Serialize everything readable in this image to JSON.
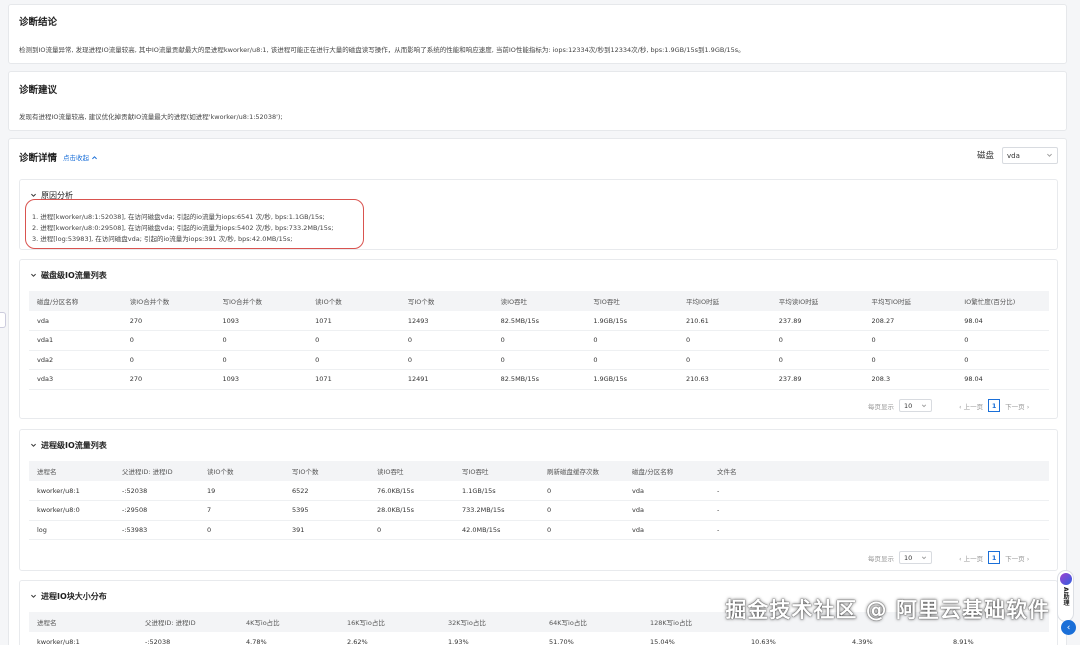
{
  "conclusion": {
    "title": "诊断结论",
    "text": "检测到IO流量异常, 发现进程IO流量较高, 其中IO流量贡献最大的是进程kworker/u8:1, 该进程可能正在进行大量的磁盘读写操作，从而影响了系统的性能和响应速度, 当前IO性能指标为: iops:12334次/秒到12334次/秒, bps:1.9GB/15s到1.9GB/15s。"
  },
  "suggestion": {
    "title": "诊断建议",
    "text": "发现有进程IO流量较高, 建议优化掉贡献IO流量最大的进程(如进程'kworker/u8:1:52038');"
  },
  "details": {
    "title": "诊断详情",
    "collapse_link": "点击收起",
    "disk_label": "磁盘",
    "disk_value": "vda"
  },
  "cause": {
    "title": "原因分析",
    "lines": [
      "1. 进程[kworker/u8:1:52038], 在访问磁盘vda; 引起的io流量为iops:6541 次/秒, bps:1.1GB/15s;",
      "2. 进程[kworker/u8:0:29508], 在访问磁盘vda; 引起的io流量为iops:5402 次/秒, bps:733.2MB/15s;",
      "3. 进程[log:53983], 在访问磁盘vda; 引起的io流量为iops:391 次/秒, bps:42.0MB/15s;"
    ]
  },
  "disk_table": {
    "title": "磁盘级IO流量列表",
    "headers": [
      "磁盘/分区名称",
      "读IO合并个数",
      "写IO合并个数",
      "读IO个数",
      "写IO个数",
      "读IO吞吐",
      "写IO吞吐",
      "平均IO时延",
      "平均读IO时延",
      "平均写IO时延",
      "IO繁忙度(百分比)"
    ],
    "rows": [
      [
        "vda",
        "270",
        "1093",
        "1071",
        "12493",
        "82.5MB/15s",
        "1.9GB/15s",
        "210.61",
        "237.89",
        "208.27",
        "98.04"
      ],
      [
        "vda1",
        "0",
        "0",
        "0",
        "0",
        "0",
        "0",
        "0",
        "0",
        "0",
        "0"
      ],
      [
        "vda2",
        "0",
        "0",
        "0",
        "0",
        "0",
        "0",
        "0",
        "0",
        "0",
        "0"
      ],
      [
        "vda3",
        "270",
        "1093",
        "1071",
        "12491",
        "82.5MB/15s",
        "1.9GB/15s",
        "210.63",
        "237.89",
        "208.3",
        "98.04"
      ]
    ]
  },
  "process_table": {
    "title": "进程级IO流量列表",
    "headers": [
      "进程名",
      "父进程ID: 进程ID",
      "读IO个数",
      "写IO个数",
      "读IO吞吐",
      "写IO吞吐",
      "刷新磁盘缓存次数",
      "磁盘/分区名称",
      "文件名"
    ],
    "rows": [
      [
        "kworker/u8:1",
        "-:52038",
        "19",
        "6522",
        "76.0KB/15s",
        "1.1GB/15s",
        "0",
        "vda",
        "-"
      ],
      [
        "kworker/u8:0",
        "-:29508",
        "7",
        "5395",
        "28.0KB/15s",
        "733.2MB/15s",
        "0",
        "vda",
        "-"
      ],
      [
        "log",
        "-:53983",
        "0",
        "391",
        "0",
        "42.0MB/15s",
        "0",
        "vda",
        "-"
      ]
    ]
  },
  "size_table": {
    "title": "进程IO块大小分布",
    "headers": [
      "进程名",
      "父进程ID: 进程ID",
      "4K写io占比",
      "16K写io占比",
      "32K写io占比",
      "64K写io占比",
      "128K写io占比",
      "",
      "",
      ""
    ],
    "rows": [
      [
        "kworker/u8:1",
        "-:52038",
        "4.78%",
        "2.62%",
        "1.93%",
        "51.70%",
        "15.04%",
        "10.63%",
        "4.39%",
        "8.91%"
      ]
    ]
  },
  "pager": {
    "per_page_label": "每页显示",
    "per_page_value": "10",
    "prev": "上一页",
    "page": "1",
    "next": "下一页"
  },
  "ai": {
    "label": "AI助理"
  },
  "watermark": "掘金技术社区 @ 阿里云基础软件",
  "colors": {
    "accent": "#1a6fd8",
    "highlight": "#d9534f"
  }
}
